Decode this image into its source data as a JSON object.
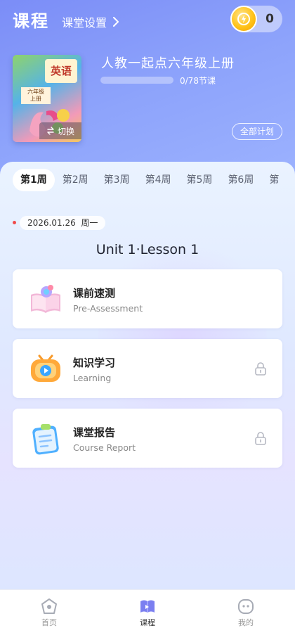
{
  "header": {
    "title": "课程",
    "settings_label": "课堂设置",
    "coin_count": "0"
  },
  "book": {
    "cover_title": "英语",
    "cover_grade": "六年级",
    "cover_term": "上册",
    "switch_label": "切换",
    "course_name": "人教一起点六年级上册",
    "progress_text": "0/78节课",
    "progress_fraction": 0.0,
    "plan_button": "全部计划"
  },
  "weeks": [
    "第1周",
    "第2周",
    "第3周",
    "第4周",
    "第5周",
    "第6周",
    "第"
  ],
  "active_week_index": 0,
  "date": {
    "date": "2026.01.26",
    "weekday": "周一"
  },
  "lesson": {
    "title": "Unit 1·Lesson 1"
  },
  "cards": [
    {
      "title": "课前速测",
      "subtitle": "Pre-Assessment",
      "icon": "book-assessment-icon",
      "locked": false
    },
    {
      "title": "知识学习",
      "subtitle": "Learning",
      "icon": "tv-play-icon",
      "locked": true
    },
    {
      "title": "课堂报告",
      "subtitle": "Course Report",
      "icon": "clipboard-report-icon",
      "locked": true
    }
  ],
  "nav": [
    {
      "label": "首页",
      "icon": "home-icon",
      "active": false
    },
    {
      "label": "课程",
      "icon": "course-book-icon",
      "active": true
    },
    {
      "label": "我的",
      "icon": "profile-icon",
      "active": false
    }
  ],
  "colors": {
    "header_gradient_start": "#7b8df7",
    "header_gradient_end": "#9fb5ff",
    "active_nav": "#7b7ff0",
    "inactive_nav": "#999999",
    "coin": "#ffc31a",
    "date_dot": "#f04a4a"
  }
}
